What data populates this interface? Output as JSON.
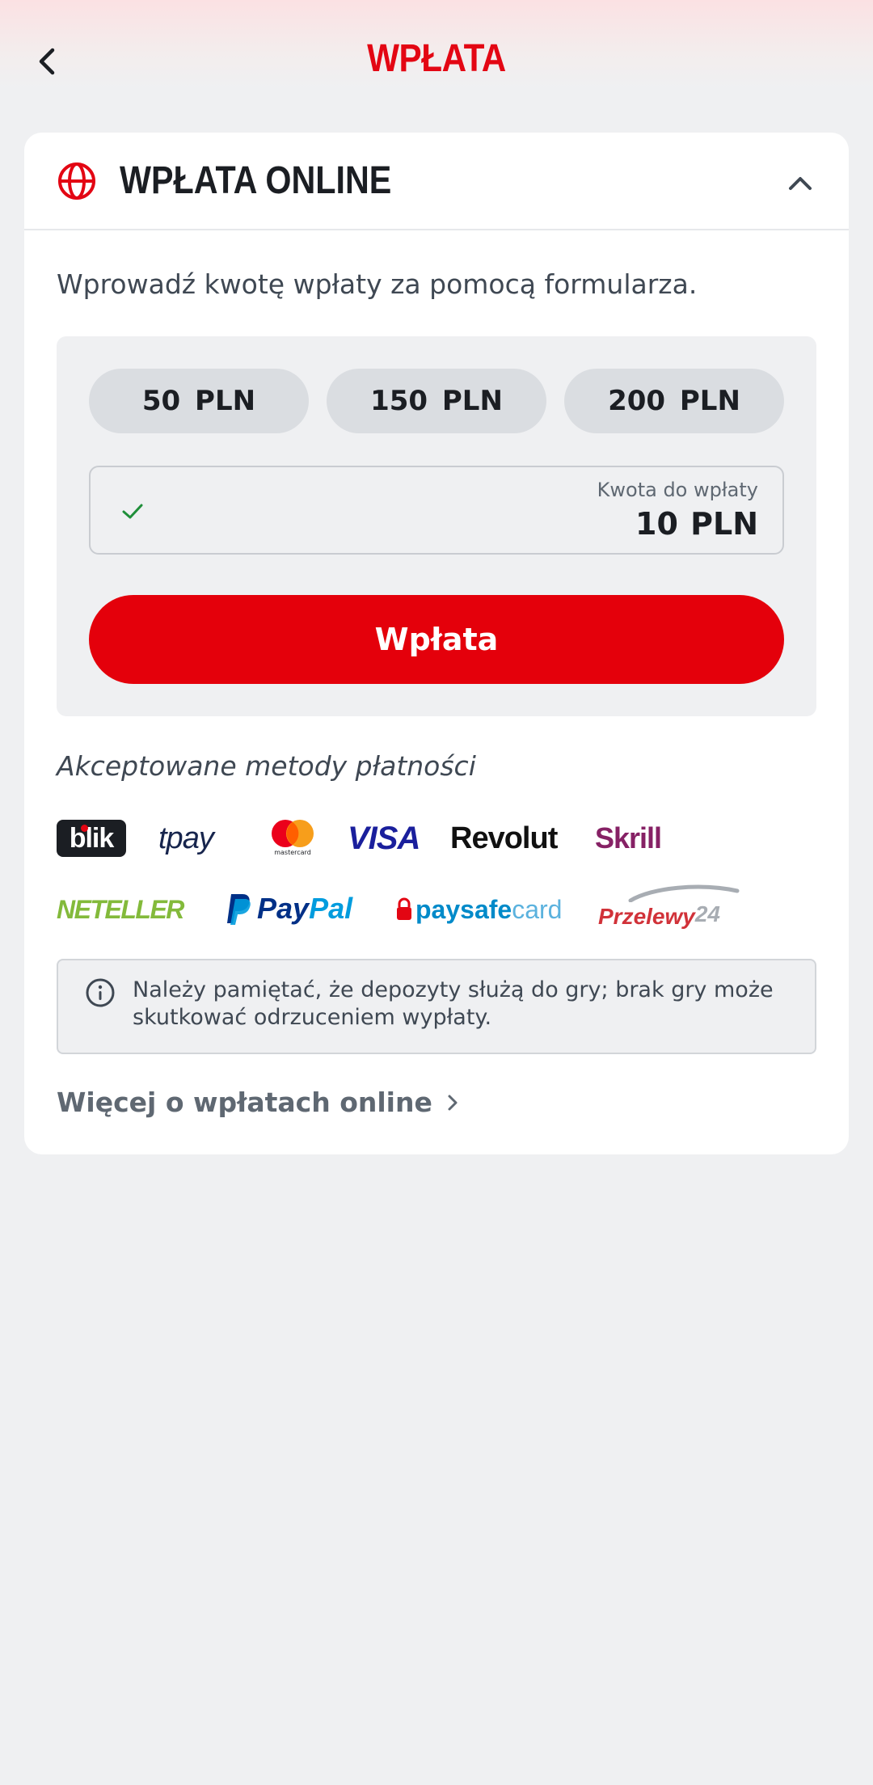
{
  "header": {
    "title": "WPŁATA"
  },
  "section": {
    "title": "WPŁATA ONLINE",
    "intro": "Wprowadź kwotę wpłaty za pomocą formularza."
  },
  "form": {
    "chips": [
      "50  PLN",
      "150  PLN",
      "200  PLN"
    ],
    "amount_label": "Kwota do wpłaty",
    "amount_value": "10 PLN",
    "submit_label": "Wpłata"
  },
  "methods": {
    "title": "Akceptowane metody płatności",
    "logos": {
      "blik": "blik",
      "tpay": "tpay",
      "mastercard": "mastercard",
      "visa": "VISA",
      "revolut": "Revolut",
      "skrill": "Skrill",
      "neteller": "NETELLER",
      "paypal_pay": "Pay",
      "paypal_pal": "Pal",
      "paysafe": "paysafe",
      "paysafe_card": "card",
      "przelewy": "Przelewy",
      "przelewy_num": "24"
    }
  },
  "notice": {
    "text": "Należy pamiętać, że depozyty służą do gry; brak gry może skutkować odrzuceniem wypłaty."
  },
  "more_link": {
    "label": "Więcej o wpłatach online"
  },
  "colors": {
    "brand_red": "#e4000b",
    "text_dark": "#1b1e23",
    "text_muted": "#5f6872",
    "success_green": "#1f8f3a"
  }
}
